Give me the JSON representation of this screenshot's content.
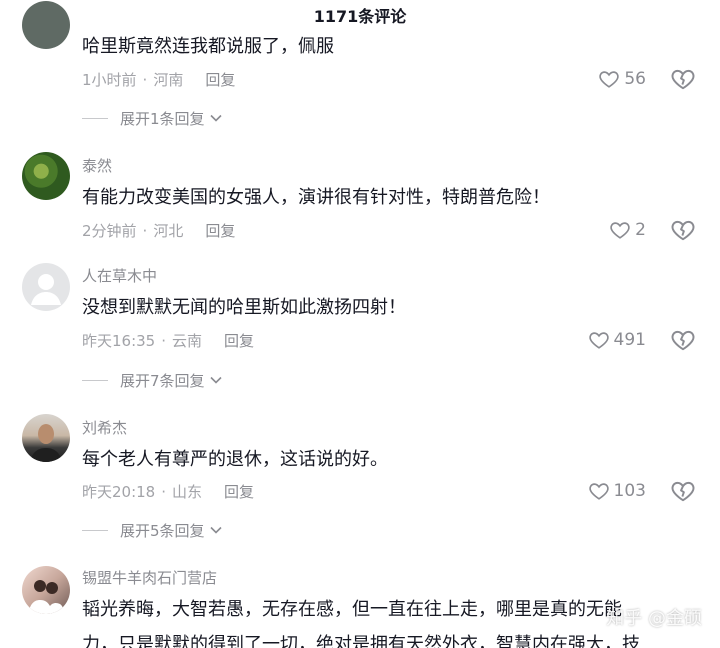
{
  "header": {
    "title": "1171条评论"
  },
  "comments": [
    {
      "username": "",
      "content": "哈里斯竟然连我都说服了，佩服",
      "time": "1小时前",
      "location": "河南",
      "reply_label": "回复",
      "likes": "56",
      "expand_label": "展开1条回复"
    },
    {
      "username": "泰然",
      "content": "有能力改变美国的女强人，演讲很有针对性，特朗普危险！",
      "time": "2分钟前",
      "location": "河北",
      "reply_label": "回复",
      "likes": "2",
      "expand_label": ""
    },
    {
      "username": "人在草木中",
      "content": "没想到默默无闻的哈里斯如此激扬四射！",
      "time": "昨天16:35",
      "location": "云南",
      "reply_label": "回复",
      "likes": "491",
      "expand_label": "展开7条回复"
    },
    {
      "username": "刘希杰",
      "content": "每个老人有尊严的退休，这话说的好。",
      "time": "昨天20:18",
      "location": "山东",
      "reply_label": "回复",
      "likes": "103",
      "expand_label": "展开5条回复"
    },
    {
      "username": "锡盟牛羊肉石门营店",
      "content": "韬光养晦，大智若愚，无存在感，但一直在往上走，哪里是真的无能",
      "content_line2": "力，只是默默的得到了一切，绝对是拥有天然外衣，智慧内在强大，技"
    }
  ],
  "watermark": "知乎 @金硕",
  "colors": {
    "text_primary": "#161823",
    "text_secondary": "#8a8b91",
    "text_meta": "#a2a3a8"
  },
  "icons": {
    "like": "heart-outline-icon",
    "dislike": "broken-heart-icon",
    "expand": "chevron-down-icon"
  }
}
